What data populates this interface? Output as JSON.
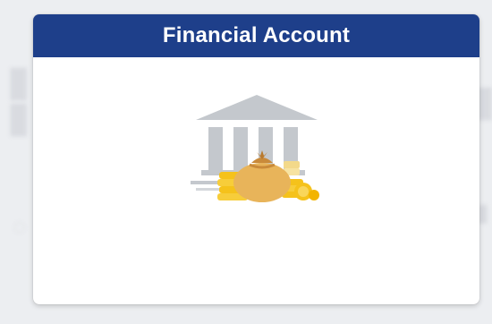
{
  "tile": {
    "title": "Financial Account",
    "icon": "bank-money-icon",
    "header_color": "#1e3f8a"
  },
  "colors": {
    "building": "#c4c8cd",
    "money_bag": "#e8b45a",
    "coins": "#f5c21b"
  }
}
